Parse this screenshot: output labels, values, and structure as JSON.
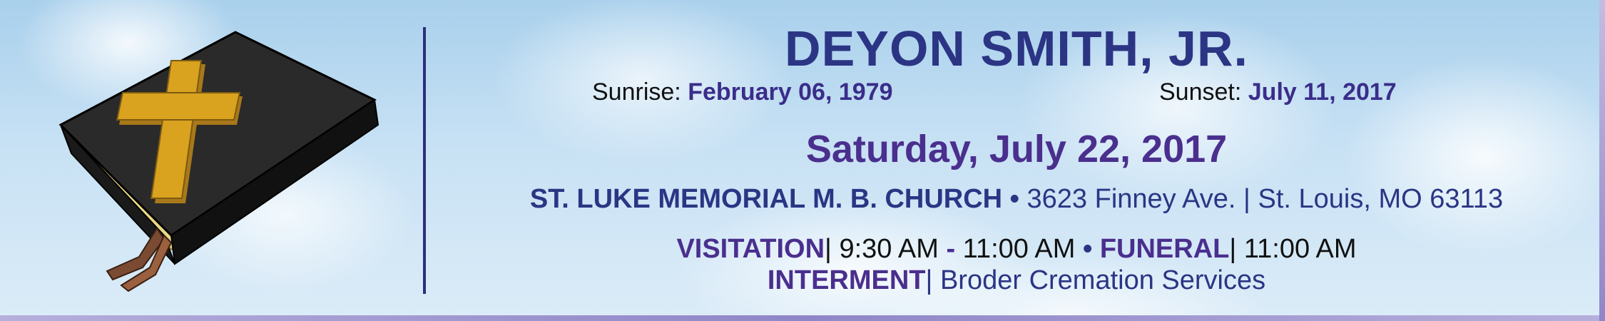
{
  "deceased": {
    "name": "DEYON SMITH, JR."
  },
  "dates": {
    "sunrise_label": "Sunrise:",
    "sunrise_date": "February 06, 1979",
    "sunset_label": "Sunset:",
    "sunset_date": "July 11, 2017"
  },
  "service": {
    "date": "Saturday, July 22, 2017",
    "church_name": "ST. LUKE MEMORIAL M. B. CHURCH",
    "separator": " • ",
    "church_address": "3623 Finney Ave. | St. Louis, MO 63113",
    "visitation_label": "VISITATION",
    "visitation_sep": "| ",
    "visitation_start": "9:30 AM",
    "visitation_dash": " - ",
    "visitation_end": "11:00 AM",
    "funeral_label": "FUNERAL",
    "funeral_sep": "| ",
    "funeral_time": "11:00 AM",
    "interment_label": "INTERMENT",
    "interment_sep": "| ",
    "interment_place": "Broder Cremation Services"
  },
  "icons": [
    "bible-icon",
    "cross-icon",
    "bookmark-ribbon-icon"
  ],
  "colors": {
    "navy": "#2b3584",
    "purple": "#4a2f8e",
    "sky": "#c7e1f4",
    "gold": "#d9a21f"
  }
}
